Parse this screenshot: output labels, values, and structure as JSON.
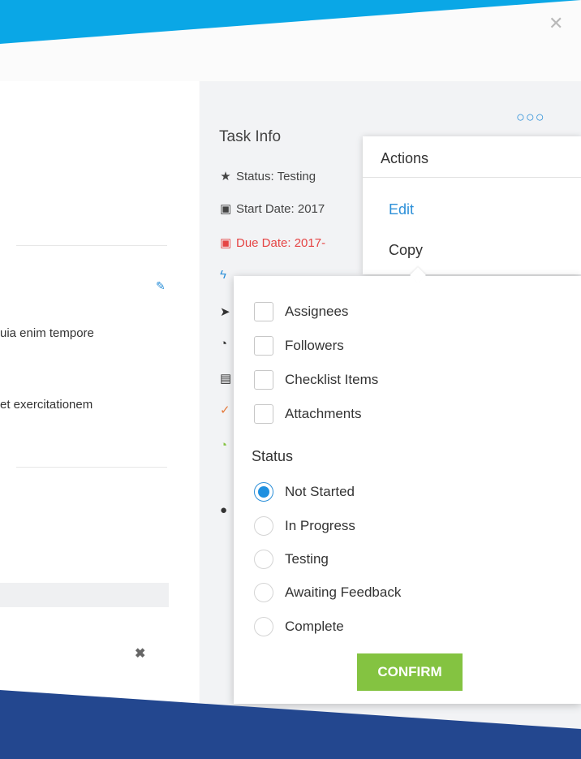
{
  "window": {
    "close_icon": "close-icon"
  },
  "left": {
    "text1": "uia enim tempore",
    "text2": "et exercitationem",
    "edit_icon": "edit-icon",
    "remove_icon": "remove-icon"
  },
  "task_info": {
    "title": "Task Info",
    "status": "Status: Testing",
    "start_date": "Start Date: 2017",
    "due_date": "Due Date: 2017-",
    "due_color": "#e54444"
  },
  "actions_popover": {
    "more_icon": "more-dots-icon",
    "title": "Actions",
    "edit": "Edit",
    "copy": "Copy"
  },
  "copy_popover": {
    "checkboxes": [
      "Assignees",
      "Followers",
      "Checklist Items",
      "Attachments"
    ],
    "status_label": "Status",
    "statuses": [
      {
        "label": "Not Started",
        "selected": true
      },
      {
        "label": "In Progress",
        "selected": false
      },
      {
        "label": "Testing",
        "selected": false
      },
      {
        "label": "Awaiting Feedback",
        "selected": false
      },
      {
        "label": "Complete",
        "selected": false
      }
    ],
    "confirm": "CONFIRM",
    "confirm_color": "#84c341"
  },
  "colors": {
    "brand_blue": "#0aa7e6",
    "dark_blue": "#23478f",
    "link_blue": "#2b8fd8"
  }
}
